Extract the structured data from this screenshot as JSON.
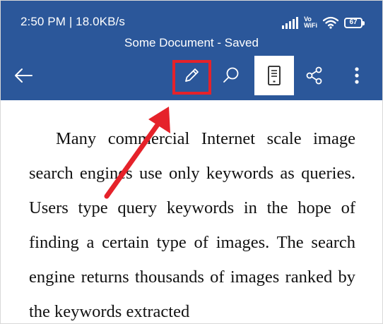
{
  "status_bar": {
    "time_speed": "2:50 PM | 18.0KB/s",
    "network_label_top": "Vo",
    "network_label_bottom": "WiFi",
    "battery_level": "67"
  },
  "app_bar": {
    "title": "Some Document - Saved",
    "icons": {
      "back": "back-arrow-icon",
      "edit": "pencil-icon",
      "search": "search-icon",
      "view": "mobile-view-icon",
      "share": "share-icon",
      "more": "more-vertical-icon"
    }
  },
  "document": {
    "paragraph": "Many commercial Internet scale image search engines use only keywords as queries. Users type query keywords in the hope of finding a certain type of images. The search engine returns thousands of images ranked by the keywords extracted"
  },
  "colors": {
    "app_bar": "#2b579a",
    "highlight": "#e5222a",
    "arrow": "#e5222a",
    "text": "#111111"
  }
}
